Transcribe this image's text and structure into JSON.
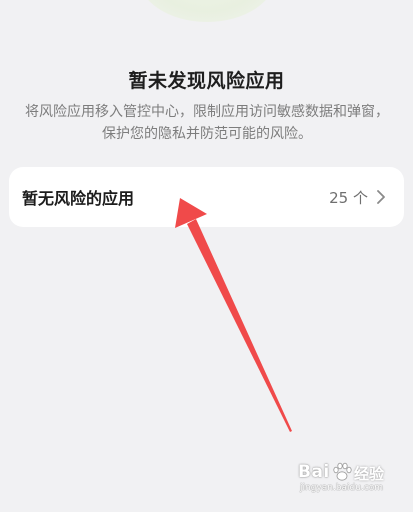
{
  "status": {
    "title": "暂未发现风险应用",
    "description": "将风险应用移入管控中心，限制应用访问敏感数据和弹窗，保护您的隐私并防范可能的风险。"
  },
  "app_card": {
    "label": "暂无风险的应用",
    "count": "25 个"
  },
  "watermark": {
    "brand_left": "Bai",
    "brand_right": "经验",
    "url": "jingyan.baidu.com"
  },
  "colors": {
    "background": "#f1f1f3",
    "card": "#ffffff",
    "arrow": "#f04a4a"
  }
}
